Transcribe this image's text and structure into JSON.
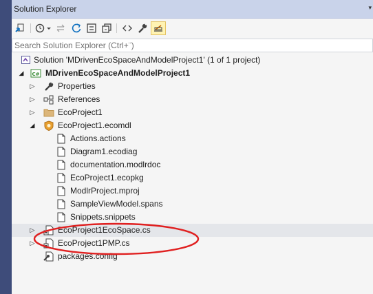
{
  "window": {
    "title": "Solution Explorer",
    "dropdown_glyph": "▾"
  },
  "search": {
    "placeholder": "Search Solution Explorer (Ctrl+¨)"
  },
  "toolbar": {
    "items": [
      "sync-icon",
      "history-icon",
      "back-forward-icon",
      "refresh-icon",
      "collapse-all-icon",
      "show-all-files-icon",
      "code-icon",
      "properties-wrench-icon",
      "preview-pin-icon"
    ]
  },
  "tree": {
    "solution": "Solution 'MDrivenEcoSpaceAndModelProject1' (1 of 1 project)",
    "project": "MDrivenEcoSpaceAndModelProject1",
    "properties": "Properties",
    "references": "References",
    "eco_folder": "EcoProject1",
    "ecomdl": "EcoProject1.ecomdl",
    "ecomdl_children": [
      "Actions.actions",
      "Diagram1.ecodiag",
      "documentation.modlrdoc",
      "EcoProject1.ecopkg",
      "ModlrProject.mproj",
      "SampleViewModel.spans",
      "Snippets.snippets"
    ],
    "ecospace_cs": "EcoProject1EcoSpace.cs",
    "pmp_cs": "EcoProject1PMP.cs",
    "packages": "packages.config"
  },
  "colors": {
    "titlebar": "#c9d3ea",
    "panel": "#f5f5f5",
    "annotation": "#e02020",
    "left_strip": "#3e4c7a"
  }
}
